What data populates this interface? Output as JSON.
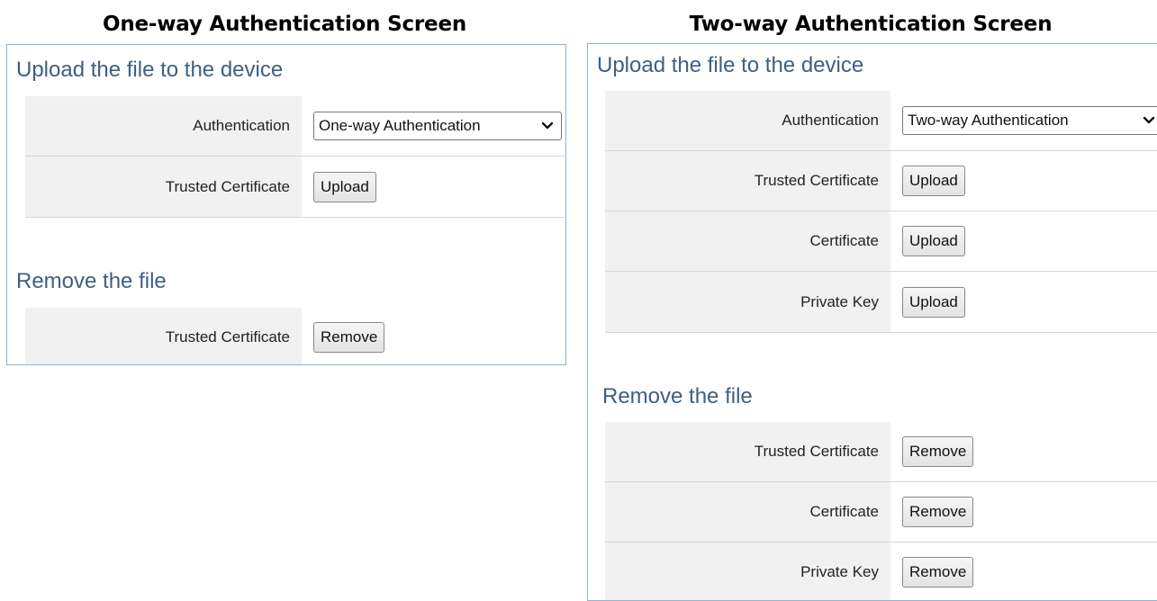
{
  "captions": {
    "left": "One-way Authentication Screen",
    "right": "Two-way Authentication Screen"
  },
  "left": {
    "upload_title": "Upload the file to the device",
    "authentication_label": "Authentication",
    "authentication_value": "One-way Authentication",
    "upload_rows": [
      {
        "label": "Trusted Certificate",
        "button": "Upload"
      }
    ],
    "remove_title": "Remove the file",
    "remove_rows": [
      {
        "label": "Trusted Certificate",
        "button": "Remove"
      }
    ]
  },
  "right": {
    "upload_title": "Upload the file to the device",
    "authentication_label": "Authentication",
    "authentication_value": "Two-way Authentication",
    "upload_rows": [
      {
        "label": "Trusted Certificate",
        "button": "Upload"
      },
      {
        "label": "Certificate",
        "button": "Upload"
      },
      {
        "label": "Private Key",
        "button": "Upload"
      }
    ],
    "remove_title": "Remove the file",
    "remove_rows": [
      {
        "label": "Trusted Certificate",
        "button": "Remove"
      },
      {
        "label": "Certificate",
        "button": "Remove"
      },
      {
        "label": "Private Key",
        "button": "Remove"
      }
    ]
  },
  "icons": {
    "dropdown": "chevron-down-icon"
  },
  "colors": {
    "section_title": "#3e5f82",
    "panel_border": "#8fb3d6",
    "label_background": "#f1f1f1"
  }
}
